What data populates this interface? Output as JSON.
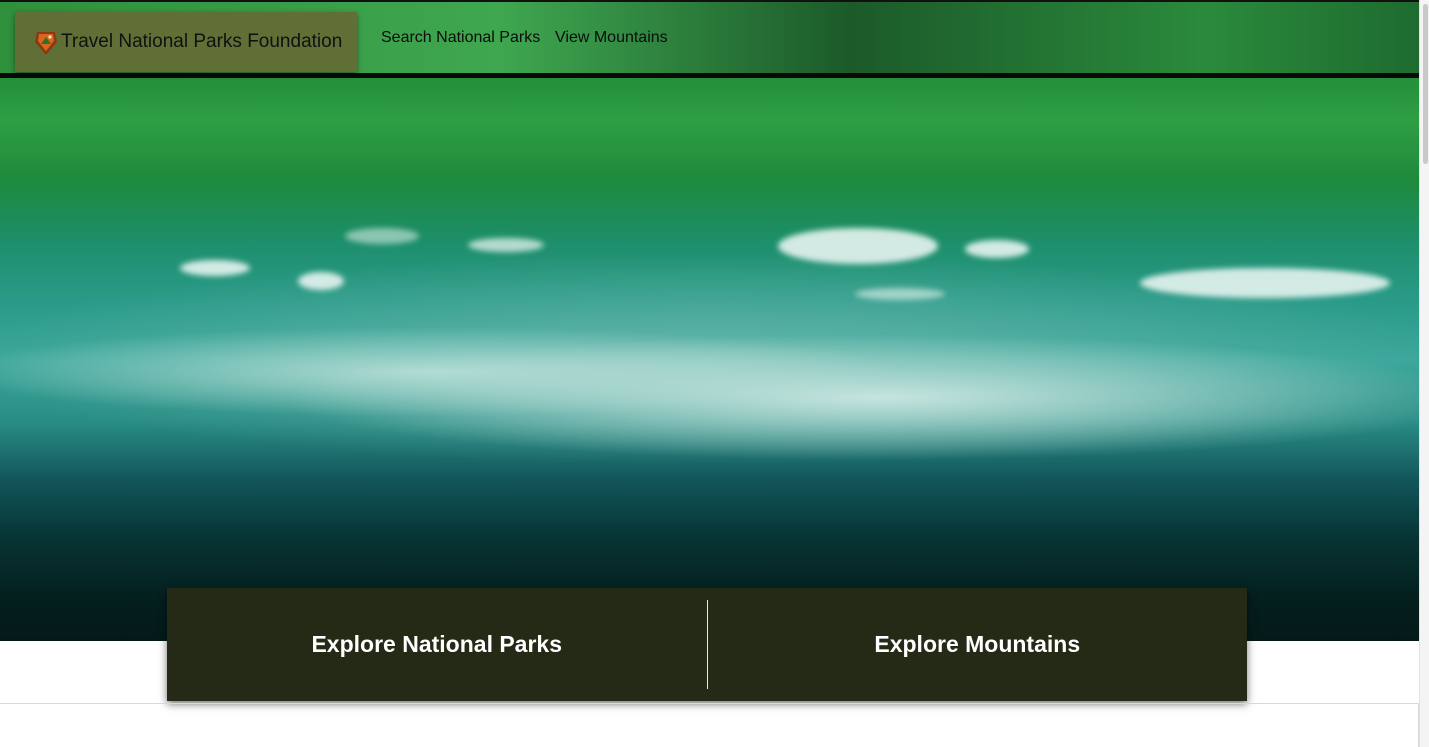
{
  "navbar": {
    "brand_title": "Travel National Parks Foundation",
    "links": [
      "Search National Parks",
      "View Mountains"
    ]
  },
  "explore": {
    "parks_label": "Explore National Parks",
    "mountains_label": "Explore Mountains"
  },
  "colors": {
    "brand_bg": "#5f6f36",
    "explore_bg": "#252a16",
    "nav_green": "#3fa750"
  },
  "icons": {
    "logo": "arrowhead-logo-icon"
  }
}
